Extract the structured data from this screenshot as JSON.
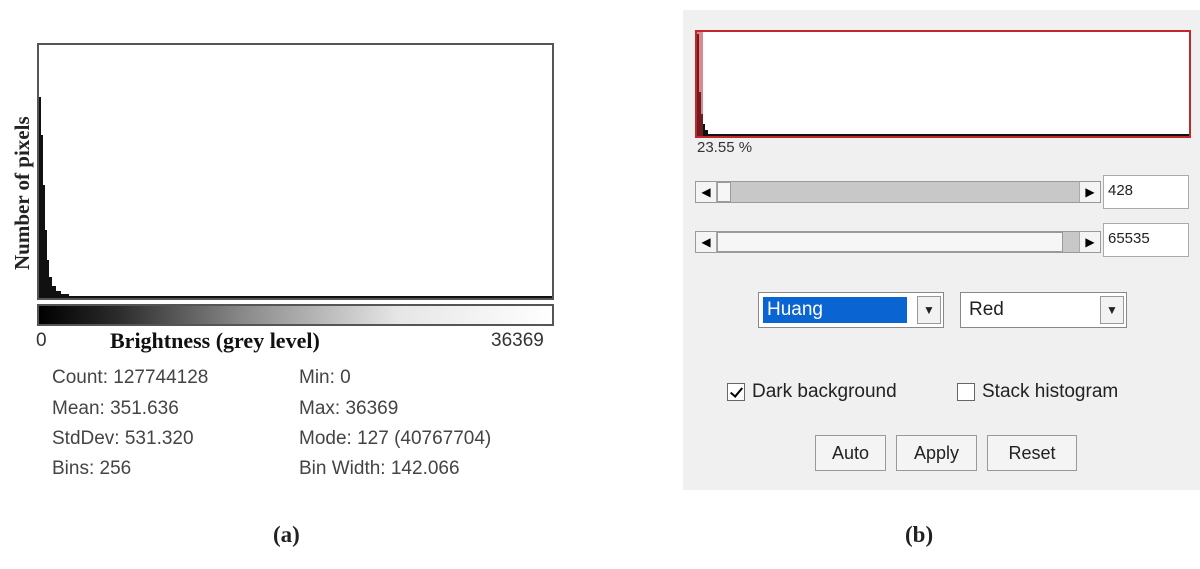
{
  "panel_a": {
    "caption": "(a)",
    "y_axis_label": "Number of pixels",
    "x_axis_label": "Brightness (grey level)",
    "x_min_label": "0",
    "x_max_label": "36369",
    "stats": [
      [
        "Count: 127744128",
        "Min: 0"
      ],
      [
        "Mean: 351.636",
        "Max: 36369"
      ],
      [
        "StdDev: 531.320",
        "Mode: 127 (40767704)"
      ],
      [
        "Bins: 256",
        "Bin Width: 142.066"
      ]
    ]
  },
  "panel_b": {
    "caption": "(b)",
    "percentage": "23.55 %",
    "min_value": "428",
    "max_value": "65535",
    "method": "Huang",
    "display_mode": "Red",
    "dark_background_label": "Dark background",
    "dark_background_checked": true,
    "stack_histogram_label": "Stack histogram",
    "stack_histogram_checked": false,
    "auto_label": "Auto",
    "apply_label": "Apply",
    "reset_label": "Reset",
    "colors": {
      "threshold_frame": "#c0282b",
      "selection": "#0a64d2"
    }
  }
}
